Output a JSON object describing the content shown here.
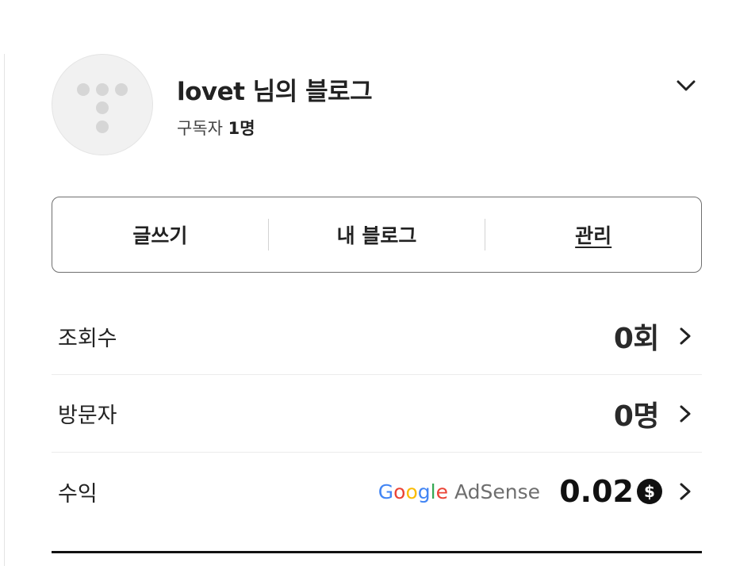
{
  "profile": {
    "blog_title": "lovet 님의 블로그",
    "subscribers_label": "구독자",
    "subscribers_count": "1명",
    "avatar_icon": "dots-logo-icon",
    "dropdown_icon": "chevron-down-icon"
  },
  "actions": [
    {
      "label": "글쓰기"
    },
    {
      "label": "내 블로그"
    },
    {
      "label": "관리"
    }
  ],
  "stats": {
    "views": {
      "label": "조회수",
      "value": "0회"
    },
    "visitors": {
      "label": "방문자",
      "value": "0명"
    },
    "revenue": {
      "label": "수익",
      "provider_google": [
        "G",
        "o",
        "o",
        "g",
        "l",
        "e"
      ],
      "provider_product": "AdSense",
      "value": "0.02",
      "currency_icon": "$"
    }
  },
  "colors": {
    "google_blue": "#4285F4",
    "google_red": "#EA4335",
    "google_yellow": "#FBBC05",
    "google_green": "#34A853",
    "text_dark": "#222222"
  }
}
